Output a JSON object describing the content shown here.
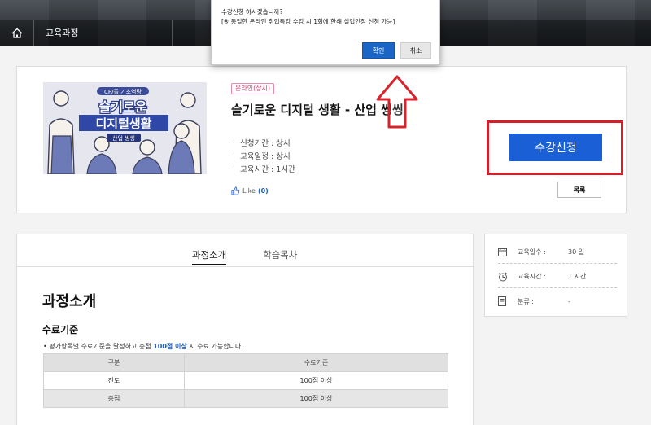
{
  "header": {
    "breadcrumb": "교육과정"
  },
  "course": {
    "badge": "온라인(상시)",
    "title": "슬기로운 디지털 생활 - 산업 씽씽",
    "info": [
      "신청기간 : 상시",
      "교육일정 : 상시",
      "교육시간 : 1시간"
    ],
    "like_label": "Like",
    "like_count": "(0)",
    "apply_label": "수강신청",
    "list_label": "목록",
    "thumbnail": {
      "top_tag": "CP/출 기초역량",
      "line1": "슬기로운",
      "line2": "디지털생활",
      "sub": "산업 씽씽"
    }
  },
  "tabs": [
    {
      "label": "과정소개",
      "active": true
    },
    {
      "label": "학습목차",
      "active": false
    }
  ],
  "content": {
    "heading": "과정소개",
    "subheading": "수료기준",
    "note_prefix": "• 평가항목별 수료기준을 달성하고 총점 ",
    "note_highlight": "100점 이상",
    "note_suffix": " 시 수료 가능합니다.",
    "table": {
      "headers": [
        "구분",
        "수료기준"
      ],
      "rows": [
        [
          "진도",
          "100점 이상"
        ],
        [
          "총점",
          "100점 이상"
        ]
      ]
    }
  },
  "side": [
    {
      "icon": "calendar-icon",
      "label": "교육일수 :",
      "value": "30 일"
    },
    {
      "icon": "alarm-clock-icon",
      "label": "교육시간 :",
      "value": "1 시간"
    },
    {
      "icon": "document-icon",
      "label": "분류 :",
      "value": "-"
    }
  ],
  "dialog": {
    "line1": "수강신청 하시겠습니까?",
    "line2": "[※ 동일한 온라인 취업특강 수강 시 1회에 한해 실업인정 신청 가능]",
    "ok_label": "확인",
    "cancel_label": "취소"
  },
  "colors": {
    "primary": "#1a5fd6",
    "highlight": "#d51e2a",
    "link": "#1c5bbd"
  }
}
